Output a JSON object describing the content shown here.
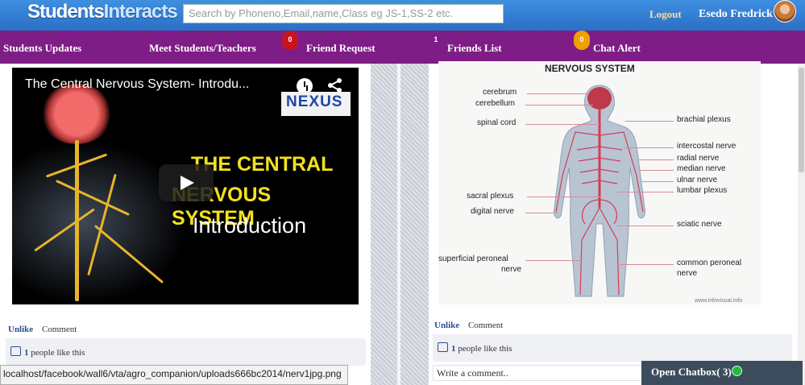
{
  "header": {
    "logo_part1": "Students",
    "logo_part2": "Interacts",
    "search_placeholder": "Search by Phoneno,Email,name,Class eg JS-1,SS-2 etc.",
    "logout_label": "Logout",
    "user_name": "Esedo Fredrick"
  },
  "nav": {
    "items": [
      {
        "label": "Students Updates"
      },
      {
        "label": "Meet Students/Teachers"
      },
      {
        "label": "Friend Request",
        "badge": "0"
      },
      {
        "label": "Friends List",
        "badge": "1"
      },
      {
        "label": "Chat Alert",
        "badge": "0"
      }
    ]
  },
  "colors": {
    "topbar": "#2a6fc4",
    "nav": "#7f1d86",
    "badge_red": "#c8141c",
    "badge_orange": "#f0a000"
  },
  "post_left": {
    "video_title": "The Central Nervous System- Introdu...",
    "video_logo": "NEXUS",
    "video_text_line1": "THE CENTRAL",
    "video_text_line2": "NERVOUS SYSTEM",
    "video_text_line3": "Introduction",
    "unlike_label": "Unlike",
    "comment_label": "Comment",
    "likes_count": "1",
    "likes_text": "people like this"
  },
  "post_right": {
    "diagram_title": "NERVOUS SYSTEM",
    "labels_left": [
      "cerebrum",
      "cerebellum",
      "spinal cord",
      "sacral plexus",
      "digital nerve",
      "superficial peroneal",
      "nerve"
    ],
    "labels_right": [
      "brachial plexus",
      "intercostal nerve",
      "radial nerve",
      "median nerve",
      "ulnar nerve",
      "lumbar plexus",
      "sciatic nerve",
      "common peroneal",
      "nerve"
    ],
    "watermark": "www.infovisual.info",
    "unlike_label": "Unlike",
    "comment_label": "Comment",
    "likes_count": "1",
    "likes_text": "people like this",
    "write_comment": "Write a comment.."
  },
  "status_url": "localhost/facebook/wall6/vta/agro_companion/uploads666bc2014/nerv1jpg.png",
  "chatbox_label": "Open Chatbox( 3)"
}
